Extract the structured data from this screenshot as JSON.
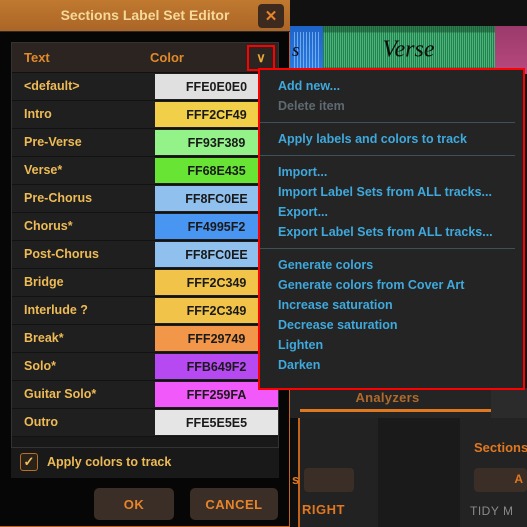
{
  "background": {
    "waveform_section_label": "Verse",
    "waveform_partial_label": "s",
    "tab_label": "Analyzers",
    "sections_panel_title": "Sections",
    "right_button_fragment": "A",
    "left_fragment": "s",
    "right_label": "RIGHT",
    "tidy_label": "TIDY M"
  },
  "dialog": {
    "title": "Sections Label Set Editor",
    "close_icon": "close-icon",
    "close_glyph": "✕",
    "table": {
      "headers": {
        "text": "Text",
        "color": "Color"
      },
      "menu_chevron": "∨",
      "rows": [
        {
          "label": "<default>",
          "color_code": "FFE0E0E0",
          "swatch": "#e0e0e0"
        },
        {
          "label": "Intro",
          "color_code": "FFF2CF49",
          "swatch": "#f2cf49"
        },
        {
          "label": "Pre-Verse",
          "color_code": "FF93F389",
          "swatch": "#93f389"
        },
        {
          "label": "Verse*",
          "color_code": "FF68E435",
          "swatch": "#68e435"
        },
        {
          "label": "Pre-Chorus",
          "color_code": "FF8FC0EE",
          "swatch": "#8fc0ee"
        },
        {
          "label": "Chorus*",
          "color_code": "FF4995F2",
          "swatch": "#4995f2"
        },
        {
          "label": "Post-Chorus",
          "color_code": "FF8FC0EE",
          "swatch": "#8fc0ee"
        },
        {
          "label": "Bridge",
          "color_code": "FFF2C349",
          "swatch": "#f2c349"
        },
        {
          "label": "Interlude ?",
          "color_code": "FFF2C349",
          "swatch": "#f2c349"
        },
        {
          "label": "Break*",
          "color_code": "FFF29749",
          "swatch": "#f29749"
        },
        {
          "label": "Solo*",
          "color_code": "FFB649F2",
          "swatch": "#b649f2"
        },
        {
          "label": "Guitar Solo*",
          "color_code": "FFF259FA",
          "swatch": "#f259fa"
        },
        {
          "label": "Outro",
          "color_code": "FFE5E5E5",
          "swatch": "#e5e5e5"
        }
      ]
    },
    "apply_checkbox": {
      "label": "Apply colors to track",
      "checked": true,
      "check_glyph": "✓"
    },
    "buttons": {
      "ok": "OK",
      "cancel": "CANCEL"
    }
  },
  "menu": {
    "items": [
      {
        "label": "Add new...",
        "disabled": false
      },
      {
        "label": "Delete item",
        "disabled": true
      },
      {
        "separator": true
      },
      {
        "label": "Apply labels and colors to track",
        "disabled": false
      },
      {
        "separator": true
      },
      {
        "label": "Import...",
        "disabled": false
      },
      {
        "label": "Import Label Sets from ALL tracks...",
        "disabled": false
      },
      {
        "label": "Export...",
        "disabled": false
      },
      {
        "label": "Export Label Sets from ALL tracks...",
        "disabled": false
      },
      {
        "separator": true
      },
      {
        "label": "Generate colors",
        "disabled": false
      },
      {
        "label": "Generate colors from Cover Art",
        "disabled": false
      },
      {
        "label": "Increase saturation",
        "disabled": false
      },
      {
        "label": "Decrease saturation",
        "disabled": false
      },
      {
        "label": "Lighten",
        "disabled": false
      },
      {
        "label": "Darken",
        "disabled": false
      }
    ]
  },
  "colors": {
    "accent": "#e07820",
    "title_text": "#f6d99a",
    "menu_link": "#3fa9dd",
    "highlight_outline": "#ff0000"
  }
}
